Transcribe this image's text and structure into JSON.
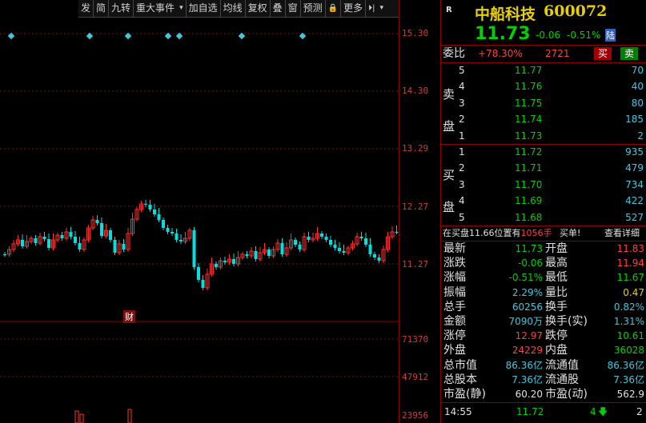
{
  "toolbar": [
    "发",
    "简",
    "九转",
    "重大事件",
    "▾",
    "加自选",
    "均线",
    "复权",
    "叠",
    "窗",
    "预测",
    "🔒",
    "更多",
    "⏵|",
    "▾"
  ],
  "price_ticks": [
    "15.30",
    "14.30",
    "13.29",
    "12.27",
    "11.27"
  ],
  "volume_ticks": [
    "71370",
    "47912",
    "23956"
  ],
  "fin_marker": "财",
  "stock": {
    "badge": "R",
    "name": "中船科技",
    "code": "600072",
    "price": "11.73",
    "change": "-0.06",
    "pct": "-0.51%",
    "market": "陆"
  },
  "weibi": {
    "label": "委比",
    "ratio": "+78.30%",
    "diff": "2721",
    "buy": "买",
    "sell": "卖"
  },
  "sell_label": [
    "卖",
    "盘"
  ],
  "buy_label": [
    "买",
    "盘"
  ],
  "asks": [
    {
      "lvl": "5",
      "price": "11.77",
      "vol": "70"
    },
    {
      "lvl": "4",
      "price": "11.76",
      "vol": "40"
    },
    {
      "lvl": "3",
      "price": "11.75",
      "vol": "80"
    },
    {
      "lvl": "2",
      "price": "11.74",
      "vol": "185"
    },
    {
      "lvl": "1",
      "price": "11.73",
      "vol": "2"
    }
  ],
  "bids": [
    {
      "lvl": "1",
      "price": "11.72",
      "vol": "935"
    },
    {
      "lvl": "2",
      "price": "11.71",
      "vol": "479"
    },
    {
      "lvl": "3",
      "price": "11.70",
      "vol": "734"
    },
    {
      "lvl": "4",
      "price": "11.69",
      "vol": "422"
    },
    {
      "lvl": "5",
      "price": "11.68",
      "vol": "527"
    }
  ],
  "notice": {
    "pre": "在买盘",
    "price": "11.66",
    "mid": "位置有",
    "vol": "1056手",
    "post": "买单!",
    "detail": "查看详细"
  },
  "quote": [
    {
      "l1": "最新",
      "v1": "11.73",
      "c1": "green",
      "l2": "开盘",
      "v2": "11.83",
      "c2": "red"
    },
    {
      "l1": "涨跌",
      "v1": "-0.06",
      "c1": "green",
      "l2": "最高",
      "v2": "11.94",
      "c2": "red"
    },
    {
      "l1": "涨幅",
      "v1": "-0.51%",
      "c1": "green",
      "l2": "最低",
      "v2": "11.67",
      "c2": "green"
    },
    {
      "l1": "振幅",
      "v1": "2.29%",
      "c1": "cyan",
      "l2": "量比",
      "v2": "0.47",
      "c2": "yellow"
    },
    {
      "l1": "总手",
      "v1": "60256",
      "c1": "cyan",
      "l2": "换手",
      "v2": "0.82%",
      "c2": "cyan"
    },
    {
      "l1": "金额",
      "v1": "7090万",
      "c1": "cyan",
      "l2": "换手(实)",
      "v2": "1.31%",
      "c2": "cyan"
    },
    {
      "l1": "涨停",
      "v1": "12.97",
      "c1": "red",
      "l2": "跌停",
      "v2": "10.61",
      "c2": "green"
    },
    {
      "l1": "外盘",
      "v1": "24229",
      "c1": "red",
      "l2": "内盘",
      "v2": "36028",
      "c2": "green"
    },
    {
      "l1": "总市值",
      "v1": "86.36亿",
      "c1": "cyan",
      "l2": "流通值",
      "v2": "86.36亿",
      "c2": "cyan"
    },
    {
      "l1": "总股本",
      "v1": "7.36亿",
      "c1": "cyan",
      "l2": "流通股",
      "v2": "7.36亿",
      "c2": "cyan"
    },
    {
      "l1": "市盈(静)",
      "v1": "60.20",
      "c1": "white",
      "l2": "市盈(动)",
      "v2": "562.9",
      "c2": "white"
    }
  ],
  "tick": {
    "time": "14:55",
    "price": "11.72",
    "vol": "4",
    "num": "2"
  }
}
